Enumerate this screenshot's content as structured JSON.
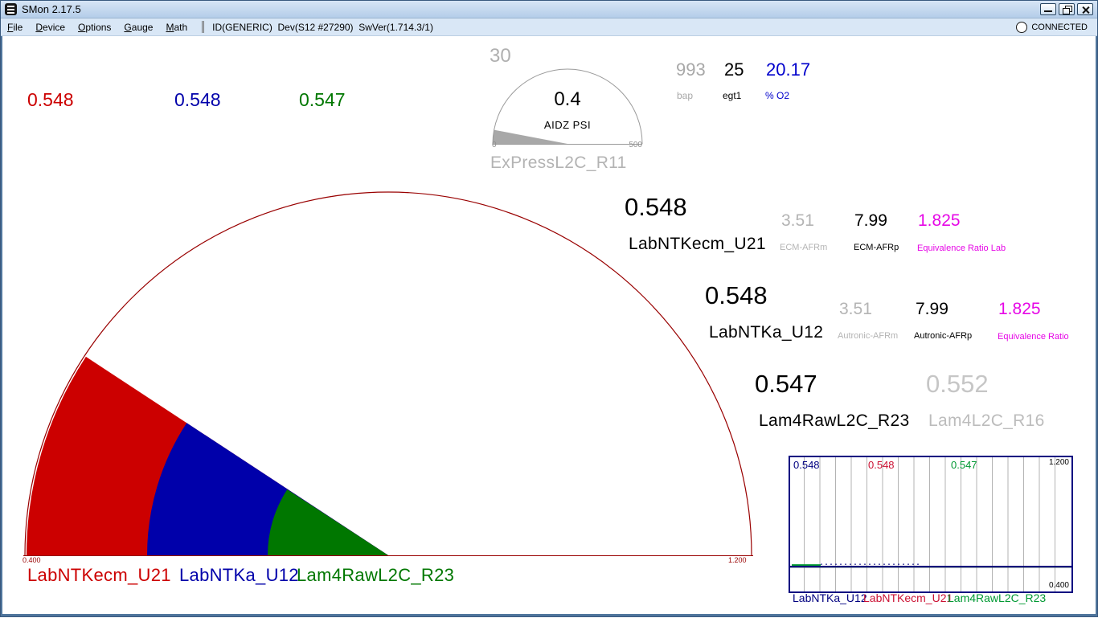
{
  "window": {
    "title": "SMon 2.17.5",
    "connected_label": "CONNECTED",
    "controls": [
      "minimize",
      "restore",
      "close"
    ]
  },
  "menubar": {
    "items": [
      "File",
      "Device",
      "Options",
      "Gauge",
      "Math"
    ],
    "device_status": "ID(GENERIC)  Dev(S12 #27290)  SwVer(1.714.3/1)"
  },
  "colors": {
    "frame": "#4f759c",
    "titlebar": "#c3d7ee",
    "menubar": "#d9e7f6",
    "gauge_arc": "#990000",
    "magenta": "#e606e6",
    "gray_value": "#b0b0b0"
  },
  "pressure_gauge": {
    "secondary_value": "30",
    "value": "0.4",
    "label": "AIDZ PSI",
    "channel": "ExPressL2C_R11",
    "scale_min": "0",
    "scale_max": "500",
    "range": [
      0,
      500
    ],
    "needle_value": 30,
    "needle_color": "#a8a8a8",
    "arc_color": "#9a9a9a"
  },
  "mini_readouts": [
    {
      "value": "993",
      "label": "bap",
      "color": "#a8a8a8"
    },
    {
      "value": "25",
      "label": "egt1",
      "color": "#000000"
    },
    {
      "value": "20.17",
      "label": "% O2",
      "color": "#0000cc"
    }
  ],
  "channel_rows": [
    {
      "value": "0.548",
      "label": "LabNTKecm_U21",
      "metrics": [
        {
          "value": "3.51",
          "label": "ECM-AFRm",
          "color": "#b4b4b4"
        },
        {
          "value": "7.99",
          "label": "ECM-AFRp",
          "color": "#000000"
        },
        {
          "value": "1.825",
          "label": "Equivalence Ratio Lab",
          "color": "#e606e6"
        }
      ]
    },
    {
      "value": "0.548",
      "label": "LabNTKa_U12",
      "metrics": [
        {
          "value": "3.51",
          "label": "Autronic-AFRm",
          "color": "#b4b4b4"
        },
        {
          "value": "7.99",
          "label": "Autronic-AFRp",
          "color": "#000000"
        },
        {
          "value": "1.825",
          "label": "Equivalence Ratio",
          "color": "#e606e6"
        }
      ]
    },
    {
      "value": "0.547",
      "label": "Lam4RawL2C_R23",
      "secondary": {
        "value": "0.552",
        "label": "Lam4L2C_R16",
        "value_color": "#c6c6c6",
        "label_color": "#bcbcbc"
      }
    }
  ],
  "lambda_gauge": {
    "range": [
      0.4,
      1.2
    ],
    "min_label": "0.400",
    "max_label": "1.200",
    "arc_color": "#990000",
    "needles": [
      {
        "name": "LabNTKecm_U21",
        "display": "0.548",
        "value": 0.548,
        "color": "#cc0000",
        "radius": 450
      },
      {
        "name": "LabNTKa_U12",
        "display": "0.548",
        "value": 0.548,
        "color": "#0000aa",
        "radius": 300
      },
      {
        "name": "Lam4RawL2C_R23",
        "display": "0.547",
        "value": 0.547,
        "color": "#007700",
        "radius": 150
      }
    ]
  },
  "chart_data": {
    "type": "line",
    "title": "",
    "ylim": [
      0.4,
      1.2
    ],
    "y_tick_labels": [
      "1.200",
      "0.400"
    ],
    "grid": "vertical",
    "legend_position": "bottom",
    "series": [
      {
        "name": "LabNTKa_U12",
        "color": "#000080",
        "current": "0.548",
        "values": [
          0.548,
          0.548,
          0.548,
          0.548,
          0.548,
          0.548,
          0.548,
          0.548
        ]
      },
      {
        "name": "LabNTKecm_U21",
        "color": "#cc1133",
        "current": "0.548",
        "values": [
          0.548,
          0.548,
          0.548,
          0.548,
          0.548,
          0.548,
          0.548,
          0.548
        ]
      },
      {
        "name": "Lam4RawL2C_R23",
        "color": "#009933",
        "current": "0.547",
        "values": [
          0.547,
          0.547,
          0.547,
          0.547,
          0.547,
          0.547,
          0.547,
          0.547
        ]
      }
    ]
  }
}
